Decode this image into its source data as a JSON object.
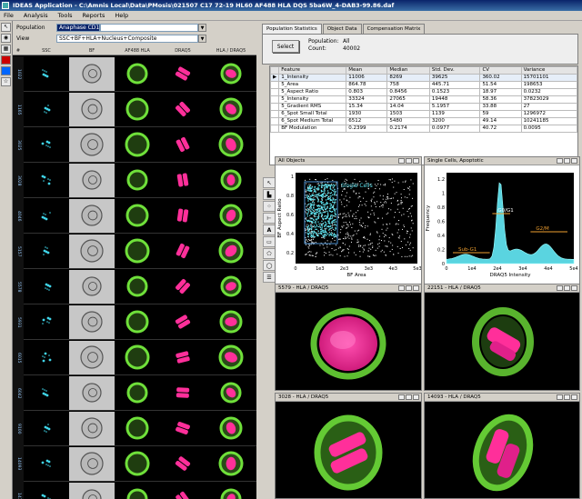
{
  "window": {
    "title": "IDEAS Application - C:\\Amnis Local\\Data\\PMosis\\021507 C17 72-19 HL60 AF488 HLA DQS 5ba6W_4-DAB3-99.86.daf"
  },
  "menu": [
    "File",
    "Analysis",
    "Tools",
    "Reports",
    "Help"
  ],
  "population": {
    "label": "Population",
    "value": "Anaphase CD1",
    "view_label": "View",
    "view_value": "SSC+BF+HLA+Nucleus+Composite"
  },
  "gallery": {
    "columns": [
      "#",
      "SSC",
      "BF",
      "AF488 HLA",
      "DRAQ5",
      "HLA / DRAQ5"
    ],
    "ids": [
      "1022",
      "1165",
      "3025",
      "3028",
      "4046",
      "5157",
      "5578",
      "5931",
      "6015",
      "6042",
      "9100",
      "14093",
      "14157"
    ]
  },
  "tabs": [
    "Population Statistics",
    "Object Data",
    "Compensation Matrix"
  ],
  "stats": {
    "select_label": "Select",
    "population_label": "Population:",
    "population_value": "All",
    "count_label": "Count:",
    "count_value": "40002"
  },
  "feature_table": {
    "headers": [
      "Feature",
      "Mean",
      "Median",
      "Std. Dev.",
      "CV",
      "Variance"
    ],
    "rows": [
      [
        "1_Intensity",
        "11006",
        "8269",
        "39625",
        "360.02",
        "15701101"
      ],
      [
        "5_Area",
        "864.78",
        "758",
        "445.71",
        "51.54",
        "198653"
      ],
      [
        "5_Aspect Ratio",
        "0.803",
        "0.8456",
        "0.1523",
        "18.97",
        "0.0232"
      ],
      [
        "5_Intensity",
        "33324",
        "27065",
        "19448",
        "58.36",
        "37823029"
      ],
      [
        "5_Gradient RMS",
        "15.34",
        "14.04",
        "5.1957",
        "33.88",
        "27"
      ],
      [
        "6_Spot Small Total",
        "1930",
        "1503",
        "1139",
        "59",
        "1296972"
      ],
      [
        "6_Spot Medium Total",
        "6512",
        "5480",
        "3200",
        "49.14",
        "10241185"
      ],
      [
        "BF Modulation",
        "0.2399",
        "0.2174",
        "0.0977",
        "40.72",
        "0.0095"
      ]
    ]
  },
  "scatter": {
    "title": "All Objects",
    "gate_label": "Single Cells",
    "xlabel": "BF Area",
    "ylabel": "BF Aspect Ratio",
    "xticks": [
      "0",
      "1e3",
      "2e3",
      "3e3",
      "4e3",
      "5e3"
    ],
    "yticks": [
      "0.2",
      "0.4",
      "0.6",
      "0.8",
      "1"
    ]
  },
  "histogram": {
    "title": "Single Cells, Apoptotic",
    "xlabel": "DRAQ5 Intensity",
    "ylabel": "Frequency",
    "xticks": [
      "0",
      "1e4",
      "2e4",
      "3e4",
      "4e4",
      "5e4"
    ],
    "yticks": [
      "0",
      "0.2",
      "0.4",
      "0.6",
      "0.8",
      "1",
      "1.2"
    ],
    "gates": [
      "G0/G1",
      "G2/M",
      "Sub-G1"
    ]
  },
  "cell_panels": [
    "5579 - HLA / DRAQ5",
    "22151 - HLA / DRAQ5",
    "3028 - HLA / DRAQ5",
    "14093 - HLA / DRAQ5"
  ],
  "colors": {
    "hla": "#6fe03a",
    "draq5": "#ff2f9a",
    "ssc": "#3fd4e8",
    "bf": "#c7c7c7",
    "scatter_dense": "#5ee0ec",
    "gate": "#4a8fd0",
    "hist_fill": "#5ad4e0"
  }
}
